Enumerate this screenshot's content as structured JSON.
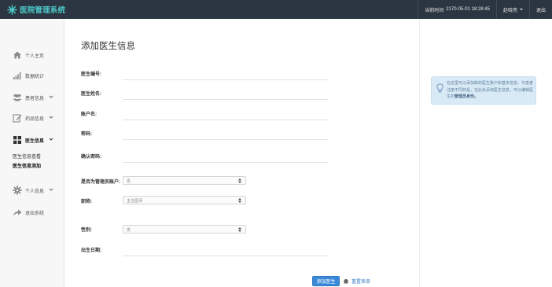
{
  "header": {
    "brand": "医院管理系统",
    "time_label": "当前时间",
    "time_value": "2170-05-01 18:28:45",
    "user": "赵晓亮",
    "logout": "退出"
  },
  "sidebar": {
    "items": [
      {
        "label": "个人主页",
        "icon": "home-icon"
      },
      {
        "label": "数据统计",
        "icon": "bar-chart-icon"
      },
      {
        "label": "患者信息",
        "icon": "users-icon"
      },
      {
        "label": "药品信息",
        "icon": "edit-icon"
      },
      {
        "label": "医生信息",
        "icon": "grid-icon"
      },
      {
        "label": "个人信息",
        "icon": "gear-icon"
      },
      {
        "label": "退出系统",
        "icon": "share-icon"
      }
    ],
    "sub_items": [
      "医生信息查看",
      "医生信息添加"
    ]
  },
  "main": {
    "title": "添加医生信息",
    "fields": {
      "doctor_id": "医生编号:",
      "doctor_name": "医生姓名:",
      "account": "账户名:",
      "password": "密码:",
      "confirm_password": "确认密码:",
      "is_admin": "是否为管理员账户:",
      "title_field": "职称:",
      "gender": "性别:",
      "birthday": "出生日期:"
    },
    "selects": {
      "is_admin": "否",
      "title_field": "主任医师",
      "gender": "男"
    },
    "buttons": {
      "add": "添加医生",
      "reset": "重置表单"
    }
  },
  "info": {
    "text": "在这里可以添加新的医生账户和基本信息。与患者注册不同的是，在此处添加医生信息，可以编辑医生的",
    "strong": "管理员身份。"
  },
  "colors": {
    "header_bg": "#2c3642",
    "brand": "#4ec7c7",
    "primary": "#3b8ad9",
    "info_bg": "#d9eaf7"
  }
}
